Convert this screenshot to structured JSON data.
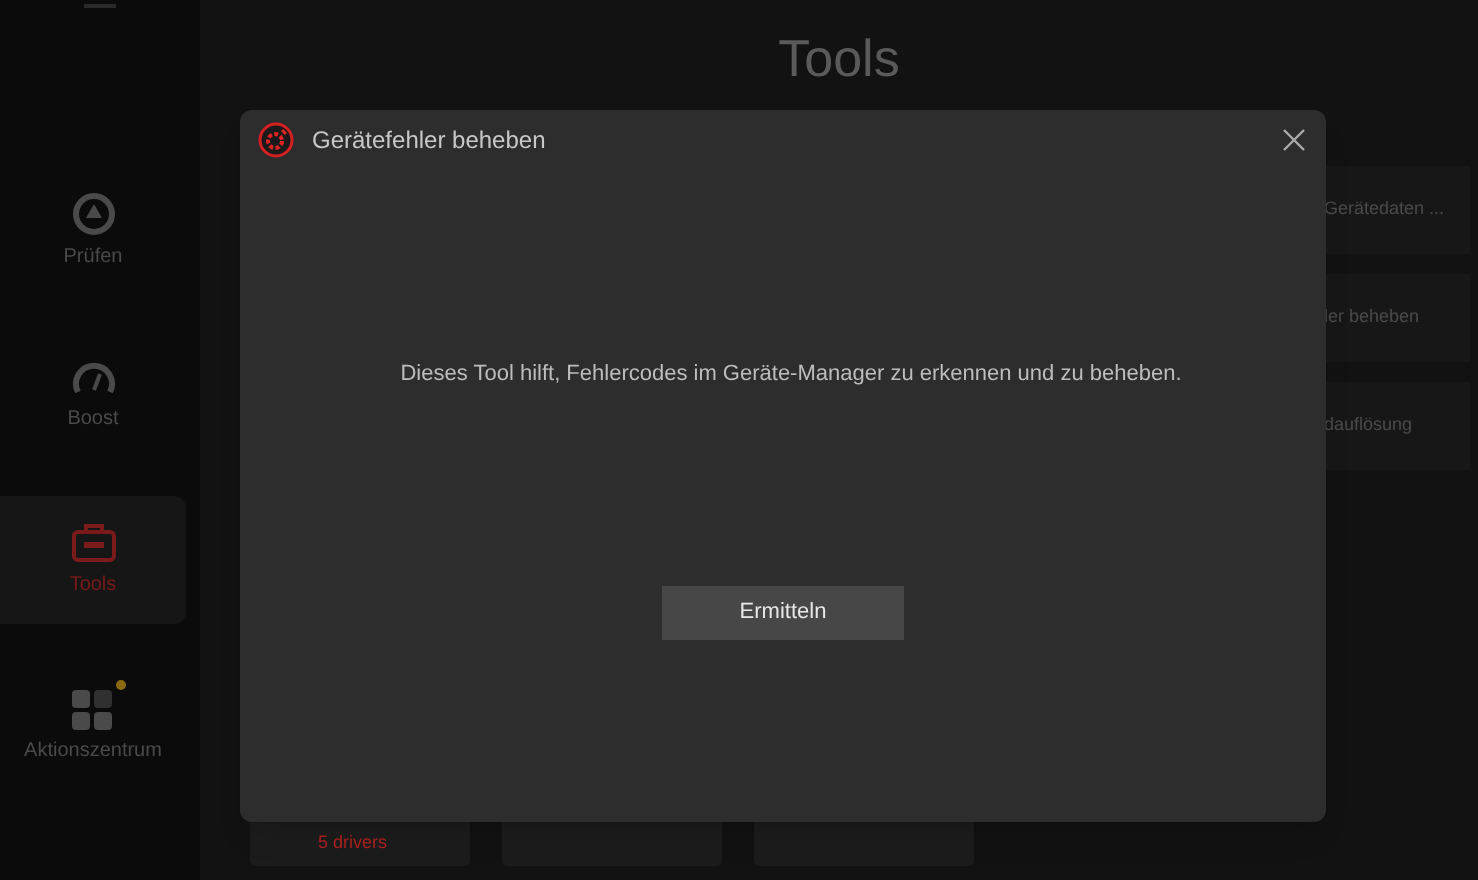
{
  "sidebar": {
    "items": [
      {
        "label": "Prüfen",
        "kind": "scan",
        "selected": false,
        "notification": false
      },
      {
        "label": "Boost",
        "kind": "gauge",
        "selected": false,
        "notification": false
      },
      {
        "label": "Tools",
        "kind": "toolbox",
        "selected": true,
        "notification": false
      },
      {
        "label": "Aktionszentrum",
        "kind": "grid",
        "selected": false,
        "notification": true
      }
    ]
  },
  "page": {
    "title": "Tools",
    "side_cards": [
      {
        "label": "Gerätedaten ..."
      },
      {
        "label": "ler beheben"
      },
      {
        "label": "dauflösung"
      }
    ],
    "bottom_cards": [
      {
        "kind": "text",
        "label": "5 drivers"
      },
      {
        "kind": "blank"
      },
      {
        "kind": "blank"
      }
    ]
  },
  "dialog": {
    "title": "Gerätefehler beheben",
    "message": "Dieses Tool hilft, Fehlercodes im Geräte-Manager zu erkennen und zu beheben.",
    "button": "Ermitteln"
  }
}
